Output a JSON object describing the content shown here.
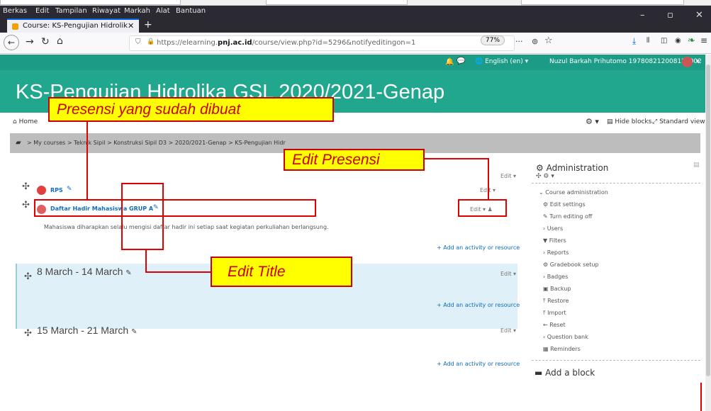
{
  "menubar": [
    "Berkas",
    "Edit",
    "Tampilan",
    "Riwayat",
    "Markah",
    "Alat",
    "Bantuan"
  ],
  "tab": {
    "title": "Course: KS-Pengujian Hidrolik"
  },
  "url": {
    "prefix": "https://elearning.",
    "domain": "pnj.ac.id",
    "path": "/course/view.php?id=5296&notifyeditingon=1",
    "zoom": "77%"
  },
  "topnav": {
    "language": "English (en)",
    "user": "Nuzul Barkah Prihutomo 197808212008121002"
  },
  "course": {
    "title": "KS-Pengujian Hidrolika GSL 2020/2021-Genap"
  },
  "toolbar": {
    "home": "Home",
    "hide_blocks": "Hide blocks",
    "standard_view": "Standard view"
  },
  "breadcrumb": {
    "text": "> My courses > Teknik Sipil > Konstruksi Sipil D3 > 2020/2021-Genap > KS-Pengujian Hidr"
  },
  "section0": {
    "edit_label": "Edit",
    "rps_label": "RPS",
    "attendance_label": "Daftar Hadir Mahasiswa GRUP A",
    "description": "Mahasiswa diharapkan selalu mengisi daftar hadir ini setiap saat kegiatan perkuliahan berlangsung.",
    "add_resource": "Add an activity or resource"
  },
  "week1": {
    "title": "8 March - 14 March",
    "edit_label": "Edit",
    "add_resource": "Add an activity or resource"
  },
  "week2": {
    "title": "15 March - 21 March",
    "edit_label": "Edit",
    "add_resource": "Add an activity or resource"
  },
  "admin": {
    "heading": "Administration",
    "course_admin": "Course administration",
    "items": [
      "Edit settings",
      "Turn editing off",
      "Users",
      "Filters",
      "Reports",
      "Gradebook setup",
      "Badges",
      "Backup",
      "Restore",
      "Import",
      "Reset",
      "Question bank",
      "Reminders"
    ]
  },
  "add_block": "Add a block",
  "annotations": {
    "presensi": "Presensi yang sudah dibuat",
    "edit_presensi": "Edit Presensi",
    "edit_title": "Edit Title"
  },
  "colors": {
    "teal": "#22a78f",
    "annotation_fill": "#ffff00",
    "annotation_border": "#cc0000"
  }
}
